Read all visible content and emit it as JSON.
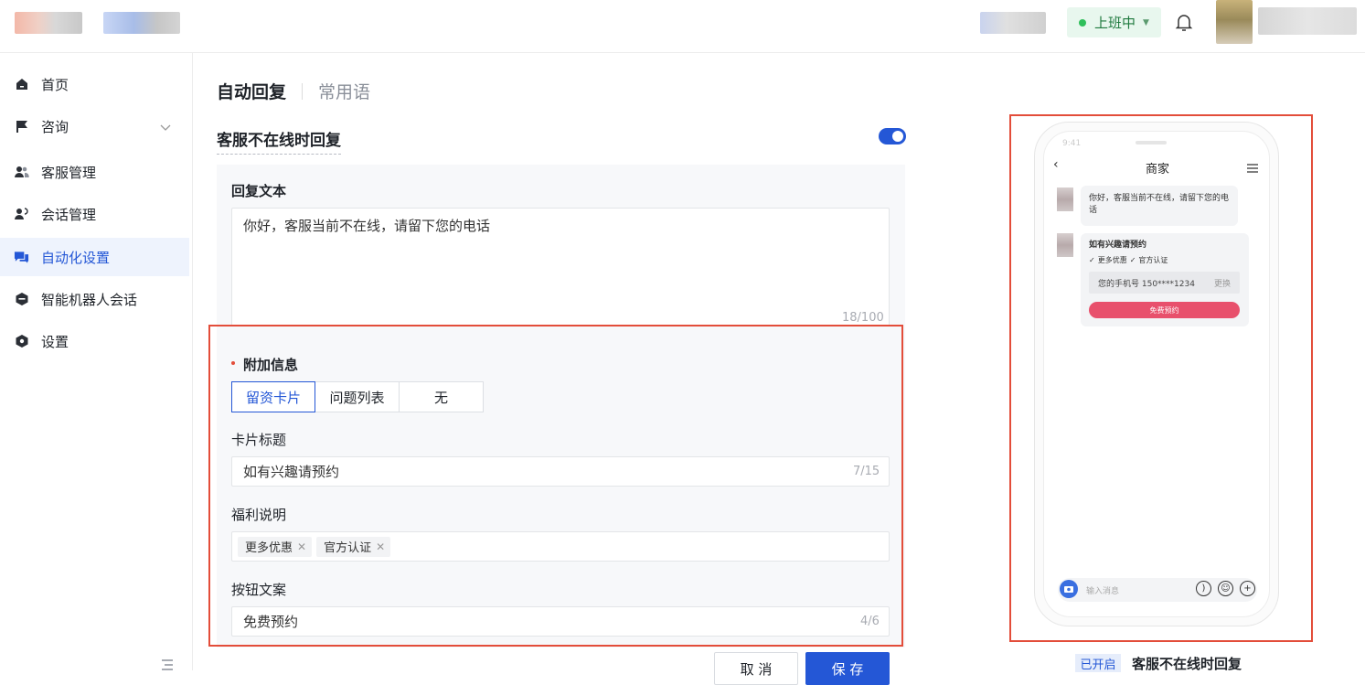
{
  "topbar": {
    "status_label": "上班中",
    "colors": {
      "status_bg": "#e8f7ee",
      "status_dot": "#2fbf5a"
    }
  },
  "sidebar": {
    "items": [
      {
        "label": "首页",
        "icon": "home-icon"
      },
      {
        "label": "咨询",
        "icon": "flag-icon"
      },
      {
        "label": "客服管理",
        "icon": "users-icon"
      },
      {
        "label": "会话管理",
        "icon": "user-chat-icon"
      },
      {
        "label": "自动化设置",
        "icon": "chat-bubbles-icon",
        "active": true
      },
      {
        "label": "智能机器人会话",
        "icon": "robot-icon"
      },
      {
        "label": "设置",
        "icon": "hexagon-settings-icon"
      }
    ]
  },
  "tabs": [
    {
      "label": "自动回复",
      "active": true
    },
    {
      "label": "常用语",
      "active": false
    }
  ],
  "section": {
    "title": "客服不在线时回复",
    "enabled": true
  },
  "form": {
    "reply_text_label": "回复文本",
    "reply_text_value": "你好，客服当前不在线，请留下您的电话",
    "reply_text_counter": "18/100",
    "extra_info_label": "附加信息",
    "extra_info_options": [
      "留资卡片",
      "问题列表",
      "无"
    ],
    "extra_info_selected": "留资卡片",
    "card_title_label": "卡片标题",
    "card_title_value": "如有兴趣请预约",
    "card_title_counter": "7/15",
    "benefit_label": "福利说明",
    "benefit_tags": [
      "更多优惠",
      "官方认证"
    ],
    "button_text_label": "按钮文案",
    "button_text_value": "免费预约",
    "button_text_counter": "4/6"
  },
  "actions": {
    "cancel": "取 消",
    "save": "保 存"
  },
  "preview": {
    "status_time": "9:41",
    "title": "商家",
    "message1": "你好，客服当前不在线，请留下您的电话",
    "card_title": "如有兴趣请预约",
    "benefit1": "更多优惠",
    "benefit2": "官方认证",
    "phone_label": "您的手机号 150****1234",
    "change_label": "更换",
    "cta": "免费预约",
    "input_placeholder": "输入消息"
  },
  "footer": {
    "badge": "已开启",
    "text": "客服不在线时回复"
  },
  "colors": {
    "primary": "#2457d6",
    "highlight_box": "#e34d3a",
    "cta": "#e8506c"
  }
}
